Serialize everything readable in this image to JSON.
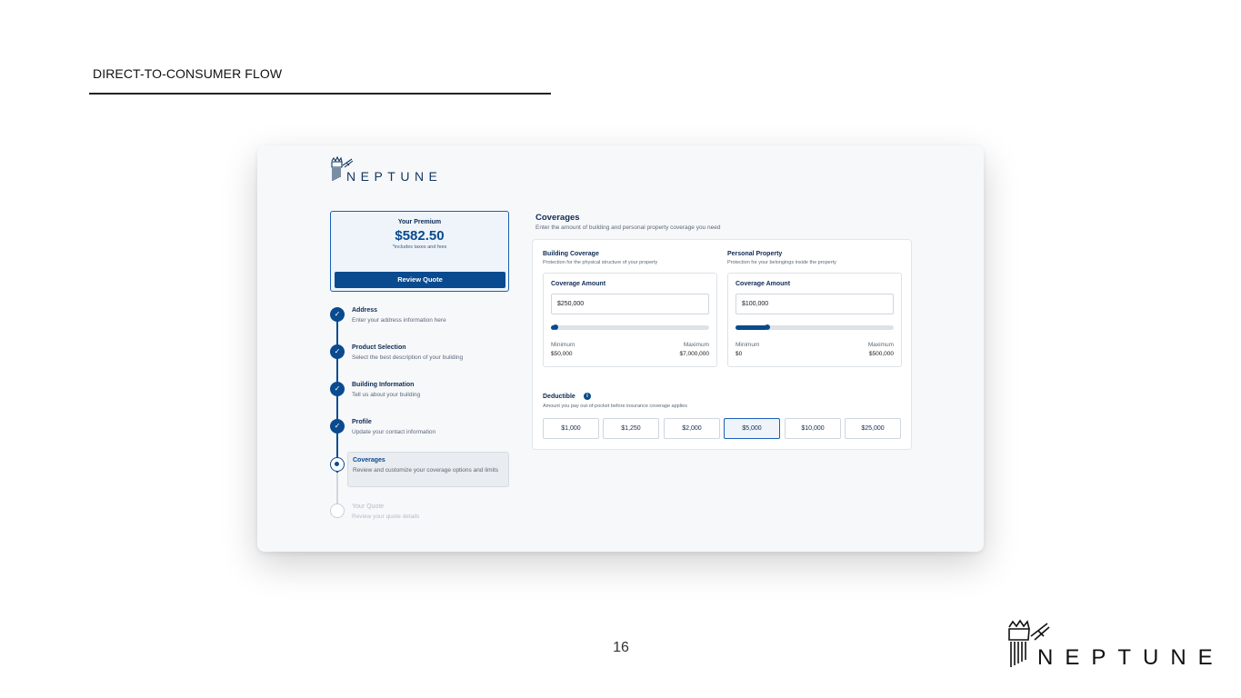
{
  "slide": {
    "title": "DIRECT-TO-CONSUMER FLOW",
    "page_number": "16",
    "brand": "NEPTUNE"
  },
  "app": {
    "brand": "NEPTUNE",
    "premium": {
      "label": "Your Premium",
      "amount": "$582.50",
      "note": "*includes taxes and fees",
      "button": "Review Quote"
    },
    "steps": [
      {
        "title": "Address",
        "desc": "Enter your address information here",
        "status": "done"
      },
      {
        "title": "Product Selection",
        "desc": "Select the best description of your building",
        "status": "done"
      },
      {
        "title": "Building Information",
        "desc": "Tell us about your building",
        "status": "done"
      },
      {
        "title": "Profile",
        "desc": "Update your contact information",
        "status": "done"
      },
      {
        "title": "Coverages",
        "desc": "Review and customize your coverage options and limits",
        "status": "current"
      },
      {
        "title": "Your Quote",
        "desc": "Review your quote details",
        "status": "future"
      }
    ],
    "coverages": {
      "title": "Coverages",
      "subtitle": "Enter the amount of building and personal property coverage you need",
      "building": {
        "title": "Building Coverage",
        "subtitle": "Protection for the physical structure of your property",
        "amount_label": "Coverage Amount",
        "value": "$250,000",
        "slider_fraction": 0.029,
        "min_label": "Minimum",
        "min_value": "$50,000",
        "max_label": "Maximum",
        "max_value": "$7,000,000"
      },
      "personal": {
        "title": "Personal Property",
        "subtitle": "Protection for your belongings inside the property",
        "amount_label": "Coverage Amount",
        "value": "$100,000",
        "slider_fraction": 0.2,
        "min_label": "Minimum",
        "min_value": "$0",
        "max_label": "Maximum",
        "max_value": "$500,000"
      },
      "deductible": {
        "title": "Deductible",
        "info_icon": "i",
        "subtitle": "Amount you pay out-of-pocket before insurance coverage applies",
        "options": [
          "$1,000",
          "$1,250",
          "$2,000",
          "$5,000",
          "$10,000",
          "$25,000"
        ],
        "selected": "$5,000"
      }
    }
  },
  "colors": {
    "primary": "#0a4a8f",
    "accent_border": "#1a5fb4",
    "text_dark": "#0e2a52"
  }
}
